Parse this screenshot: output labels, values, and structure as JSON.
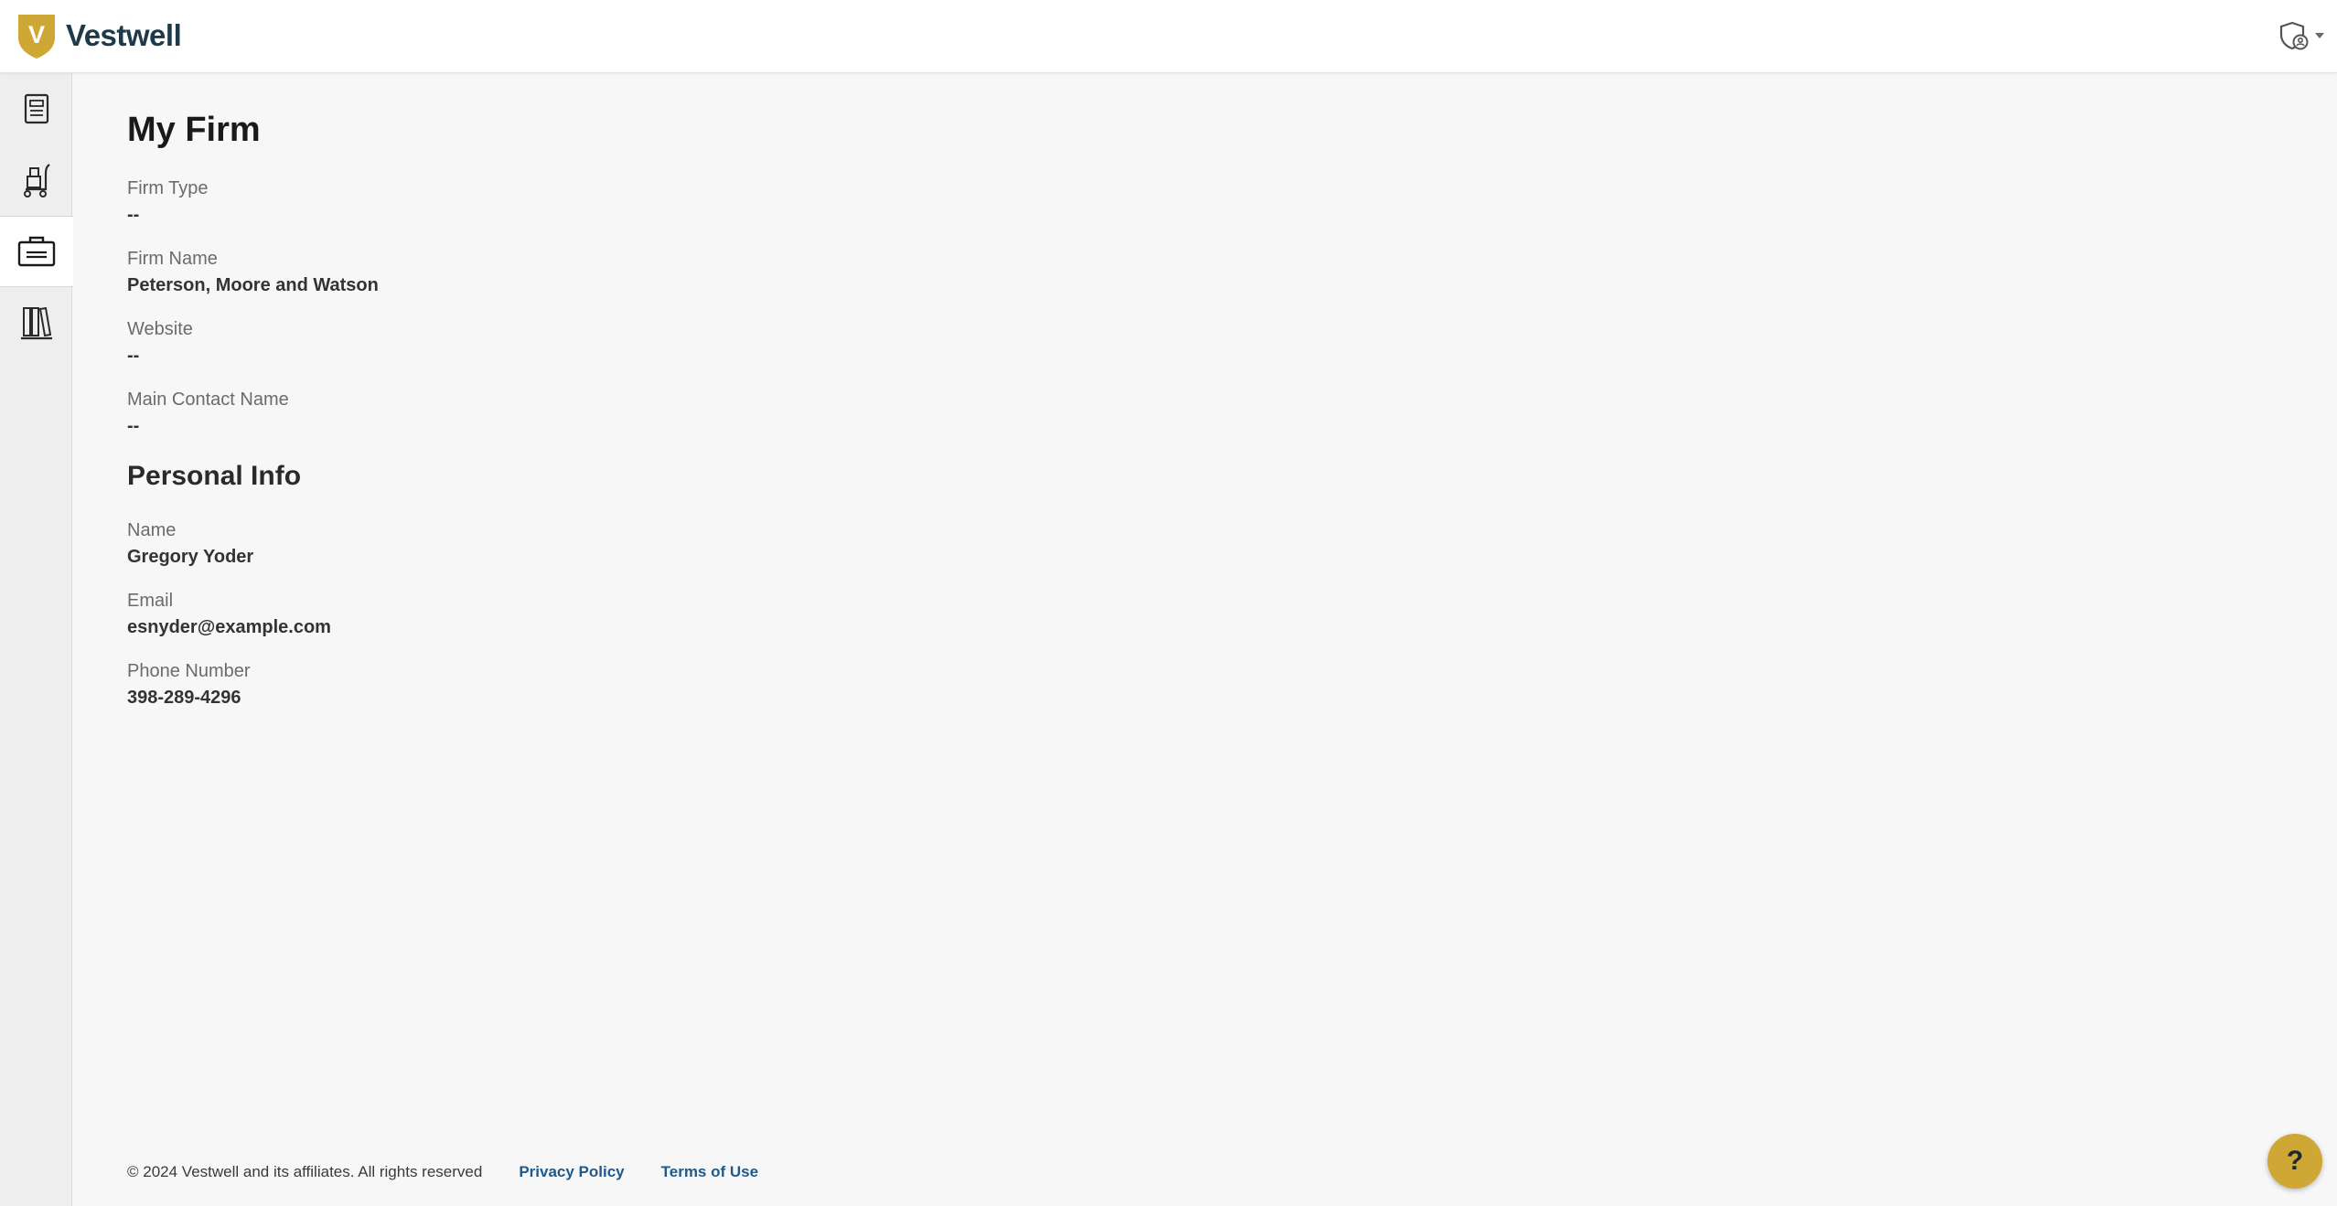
{
  "header": {
    "brand_name": "Vestwell",
    "brand_letter": "V",
    "user_menu_icon": "shield-user-icon"
  },
  "sidebar": {
    "items": [
      {
        "icon": "document-list-icon",
        "active": false
      },
      {
        "icon": "hand-truck-icon",
        "active": false
      },
      {
        "icon": "briefcase-icon",
        "active": true
      },
      {
        "icon": "library-books-icon",
        "active": false
      }
    ]
  },
  "firm": {
    "title": "My Firm",
    "fields": [
      {
        "label": "Firm Type",
        "value": "--"
      },
      {
        "label": "Firm Name",
        "value": "Peterson, Moore and Watson"
      },
      {
        "label": "Website",
        "value": "--"
      },
      {
        "label": "Main Contact Name",
        "value": "--"
      }
    ]
  },
  "personal": {
    "title": "Personal Info",
    "fields": [
      {
        "label": "Name",
        "value": "Gregory Yoder"
      },
      {
        "label": "Email",
        "value": "esnyder@example.com"
      },
      {
        "label": "Phone Number",
        "value": "398-289-4296"
      }
    ]
  },
  "footer": {
    "copyright": "© 2024 Vestwell and its affiliates. All rights reserved",
    "privacy_label": "Privacy Policy",
    "terms_label": "Terms of Use"
  },
  "help": {
    "label": "?"
  },
  "colors": {
    "brand_gold": "#cfa735",
    "brand_navy": "#1d3a4a",
    "link_blue": "#1f5a8a"
  }
}
